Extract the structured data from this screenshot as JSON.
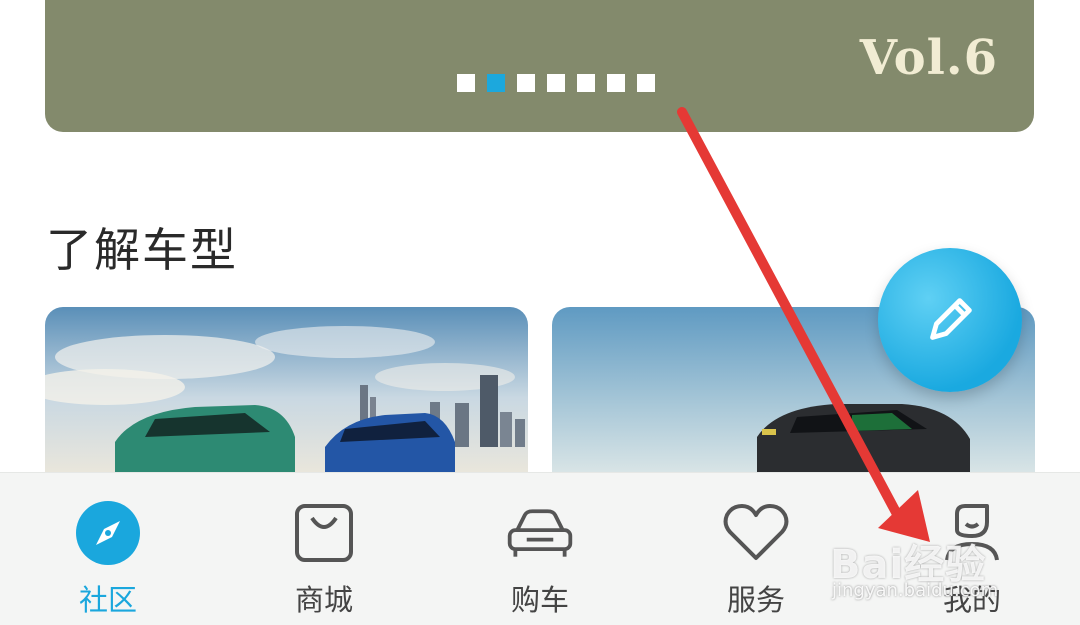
{
  "banner": {
    "vol_text": "Vol.6",
    "background_color": "#838a6c",
    "carousel": {
      "total": 7,
      "active_index": 1,
      "active_color": "#1ca8dd"
    }
  },
  "section": {
    "title": "了解车型"
  },
  "cards": [
    {
      "name": "model-card-1"
    },
    {
      "name": "model-card-2"
    }
  ],
  "fab": {
    "icon": "pencil-icon",
    "color": "#1aa9e0"
  },
  "bottom_nav": {
    "active_color": "#1aa7dd",
    "items": [
      {
        "label": "社区",
        "icon": "compass-icon",
        "active": true
      },
      {
        "label": "商城",
        "icon": "shopping-bag-icon",
        "active": false
      },
      {
        "label": "购车",
        "icon": "car-icon",
        "active": false
      },
      {
        "label": "服务",
        "icon": "heart-icon",
        "active": false
      },
      {
        "label": "我的",
        "icon": "user-icon",
        "active": false
      }
    ]
  },
  "watermark": {
    "main": "Bai经验",
    "sub": "jingyan.baidu.com"
  },
  "annotation": {
    "arrow_color": "#e53935"
  }
}
